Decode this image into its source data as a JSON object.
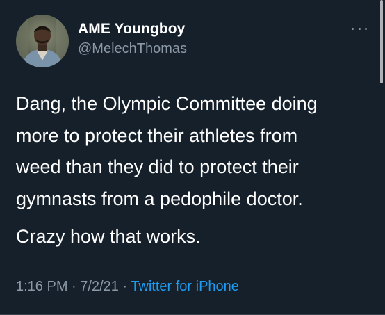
{
  "author": {
    "name": "AME Youngboy",
    "handle": "@MelechThomas",
    "avatar_icon": "profile-photo"
  },
  "menu": {
    "icon": "more-options-icon"
  },
  "tweet": {
    "paragraphs": [
      "Dang, the Olympic Committee doing",
      "more to protect their athletes from",
      "weed than they did to protect their",
      "gymnasts from a pedophile doctor.",
      "Crazy how that works."
    ]
  },
  "meta": {
    "time": "1:16 PM",
    "sep1": " · ",
    "date": "7/2/21",
    "sep2": " · ",
    "source": "Twitter for iPhone"
  },
  "colors": {
    "background": "#15202b",
    "text": "#ffffff",
    "secondary": "#8b98a5",
    "accent": "#1d9bf0"
  }
}
